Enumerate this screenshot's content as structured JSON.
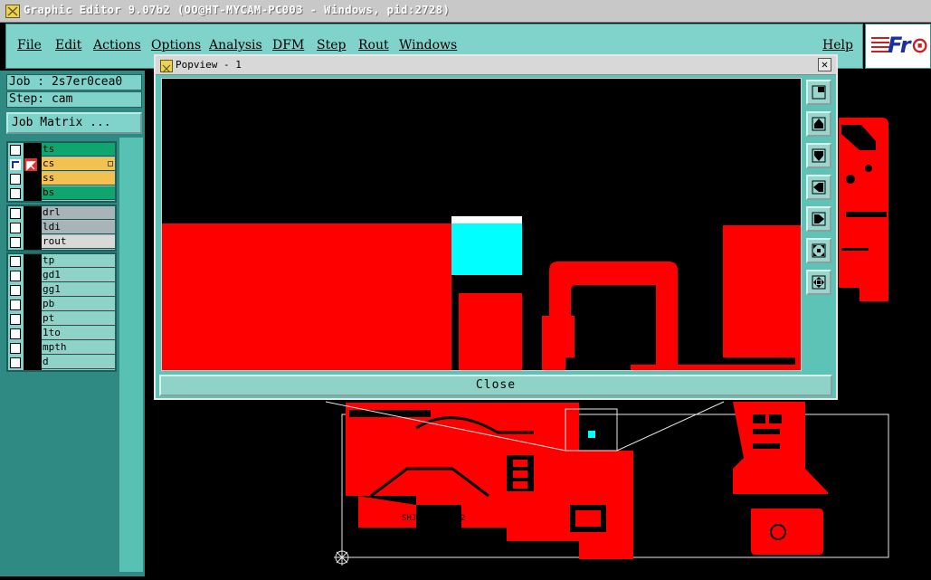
{
  "window": {
    "title": "Graphic Editor 9.07b2 (OO@HT-MYCAM-PC003 - Windows, pid:2728)"
  },
  "menu": {
    "items": [
      {
        "label": "File"
      },
      {
        "label": "Edit"
      },
      {
        "label": "Actions"
      },
      {
        "label": "Options"
      },
      {
        "label": "Analysis"
      },
      {
        "label": "DFM"
      },
      {
        "label": "Step"
      },
      {
        "label": "Rout"
      },
      {
        "label": "Windows"
      }
    ],
    "help": "Help"
  },
  "logo": {
    "text": "Fr"
  },
  "left_panel": {
    "job": "Job : 2s7er0cea0",
    "step": "Step: cam",
    "job_matrix_button": "Job Matrix ..."
  },
  "layers": {
    "group1": [
      {
        "name": "ts",
        "color": "#0fa56f",
        "active": false
      },
      {
        "name": "cs",
        "color": "#f2c14f",
        "active": true
      },
      {
        "name": "ss",
        "color": "#f2c14f",
        "active": false
      },
      {
        "name": "bs",
        "color": "#0fa56f",
        "active": false
      }
    ],
    "group2": [
      {
        "name": "drl",
        "color": "#a9b4b8"
      },
      {
        "name": "ldi",
        "color": "#a9b4b8"
      },
      {
        "name": "rout",
        "color": "#d9d9d9"
      }
    ],
    "group3": [
      {
        "name": "tp"
      },
      {
        "name": "gd1"
      },
      {
        "name": "gg1"
      },
      {
        "name": "pb"
      },
      {
        "name": "pt"
      },
      {
        "name": "1to"
      },
      {
        "name": "mpth"
      },
      {
        "name": "d"
      }
    ]
  },
  "popup": {
    "title": "Popview - 1",
    "close_x": "✕",
    "close_button": "Close",
    "toolbar_icons": [
      "zoom-fit-icon",
      "pan-up-icon",
      "pan-down-icon",
      "pan-left-icon",
      "pan-right-icon",
      "zoom-in-icon",
      "zoom-out-icon"
    ]
  },
  "board": {
    "silkscreen_label": "SHJuTR0844A-2",
    "silkscreen_label_2": "S+ZU2H1-+05"
  },
  "colors": {
    "copper": "#ff0000",
    "highlight": "#00ffff",
    "background": "#000000",
    "panel": "#7fd3cb"
  }
}
